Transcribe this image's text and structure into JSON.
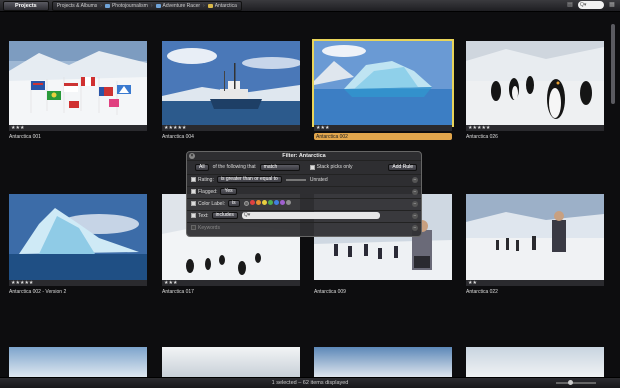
{
  "toolbar": {
    "projects_label": "Projects",
    "breadcrumbs": [
      {
        "label": "Projects & Albums",
        "icon": "folder-icon"
      },
      {
        "label": "Photojournalism",
        "icon": "folder-icon"
      },
      {
        "label": "Adventure Racer",
        "icon": "folder-icon"
      },
      {
        "label": "Antarctica",
        "icon": "folder-icon"
      }
    ],
    "search_placeholder": "Q▾"
  },
  "thumbnails": [
    {
      "caption": "Antarctica 001",
      "stars": "★★★",
      "scene": "flags"
    },
    {
      "caption": "Antarctica 004",
      "stars": "★★★★★",
      "scene": "ship"
    },
    {
      "caption": "Antarctica 002",
      "stars": "★★★",
      "scene": "iceberg",
      "selected": true
    },
    {
      "caption": "Antarctica 026",
      "stars": "★★★★★",
      "scene": "penguins"
    },
    {
      "caption": "Antarctica 002 - Version 2",
      "stars": "★★★★★",
      "scene": "iceberg2"
    },
    {
      "caption": "Antarctica 017",
      "stars": "★★★",
      "scene": "penguins2"
    },
    {
      "caption": "Antarctica 009",
      "stars": "",
      "scene": "hikers"
    },
    {
      "caption": "Antarctica 022",
      "stars": "★★",
      "scene": "hikers2"
    }
  ],
  "filter": {
    "title": "Filter: Antarctica",
    "all_option": "All",
    "following_text": "of the following that",
    "match_option": "match",
    "stack_picks_label": "Stack picks only",
    "add_rule_label": "Add Rule",
    "rating_label": "Rating:",
    "rating_condition": "is greater than or equal to",
    "rating_value": "Unrated",
    "flagged_label": "Flagged:",
    "flagged_value": "Yes",
    "color_label": "Color Label:",
    "color_condition": "is",
    "colors": [
      "#e04040",
      "#e89030",
      "#e8d040",
      "#50b050",
      "#4080e0",
      "#a060d0",
      "#909090"
    ],
    "text_label": "Text:",
    "text_condition": "includes",
    "text_placeholder": "Q▾",
    "keywords_label": "Keywords"
  },
  "status": {
    "text": "1 selected – 62 items displayed"
  }
}
